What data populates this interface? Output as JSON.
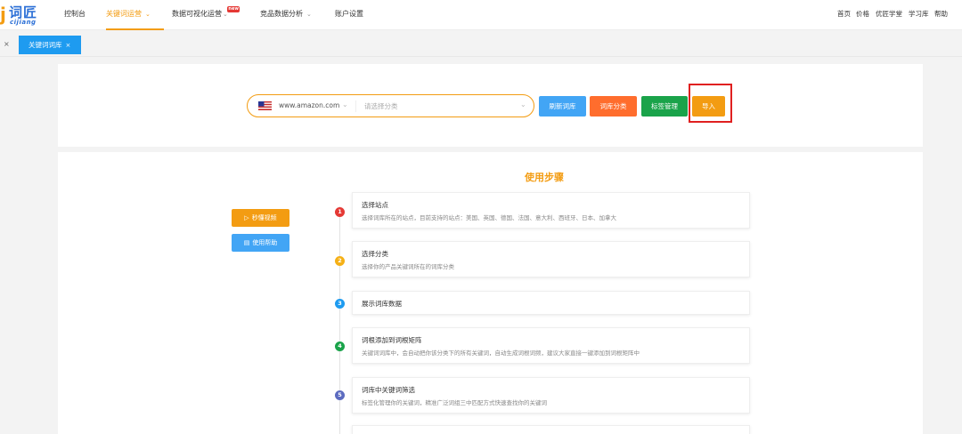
{
  "nav": {
    "logo_cn": "词匠",
    "logo_en": "cijiang",
    "items": [
      {
        "label": "控制台"
      },
      {
        "label": "关键词运营"
      },
      {
        "label": "数据可视化运营"
      },
      {
        "label": "竞品数据分析"
      },
      {
        "label": "账户设置"
      }
    ],
    "new_badge": "new",
    "right_links": [
      "首页",
      "价格",
      "优匠学堂",
      "学习库",
      "帮助"
    ]
  },
  "tabs": {
    "left_close": "×",
    "active_tab": "关键词词库",
    "tab_close": "×"
  },
  "search": {
    "site": "www.amazon.com",
    "category_placeholder": "请选择分类"
  },
  "buttons": {
    "refresh": "刷新词库",
    "classify": "词库分类",
    "tags": "标签管理",
    "import": "导入"
  },
  "guide": {
    "title": "使用步骤",
    "video_btn": "秒懂视频",
    "help_btn": "使用帮助",
    "steps": [
      {
        "num": "1",
        "title": "选择站点",
        "desc": "选择词库所在的站点，目前支持的站点：美国、英国、德国、法国、意大利、西班牙、日本、加拿大"
      },
      {
        "num": "2",
        "title": "选择分类",
        "desc": "选择你的产品关键词所在的词库分类"
      },
      {
        "num": "3",
        "title": "展示词库数据",
        "desc": ""
      },
      {
        "num": "4",
        "title": "词根添加到词根矩阵",
        "desc": "关键词词库中，会自动把你该分类下的所有关键词，自动生成词根词频，建议大家直接一键添加到词根矩阵中"
      },
      {
        "num": "5",
        "title": "词库中关键词筛选",
        "desc": "标签化管理你的关键词，精准广泛词组三中匹配方式快速查找你的关键词"
      }
    ]
  },
  "colors": {
    "accent_orange": "#f39c12",
    "blue": "#42a5f5",
    "orange_red": "#ff6d2d",
    "green": "#1aa34a",
    "highlight_red": "#e02020"
  }
}
